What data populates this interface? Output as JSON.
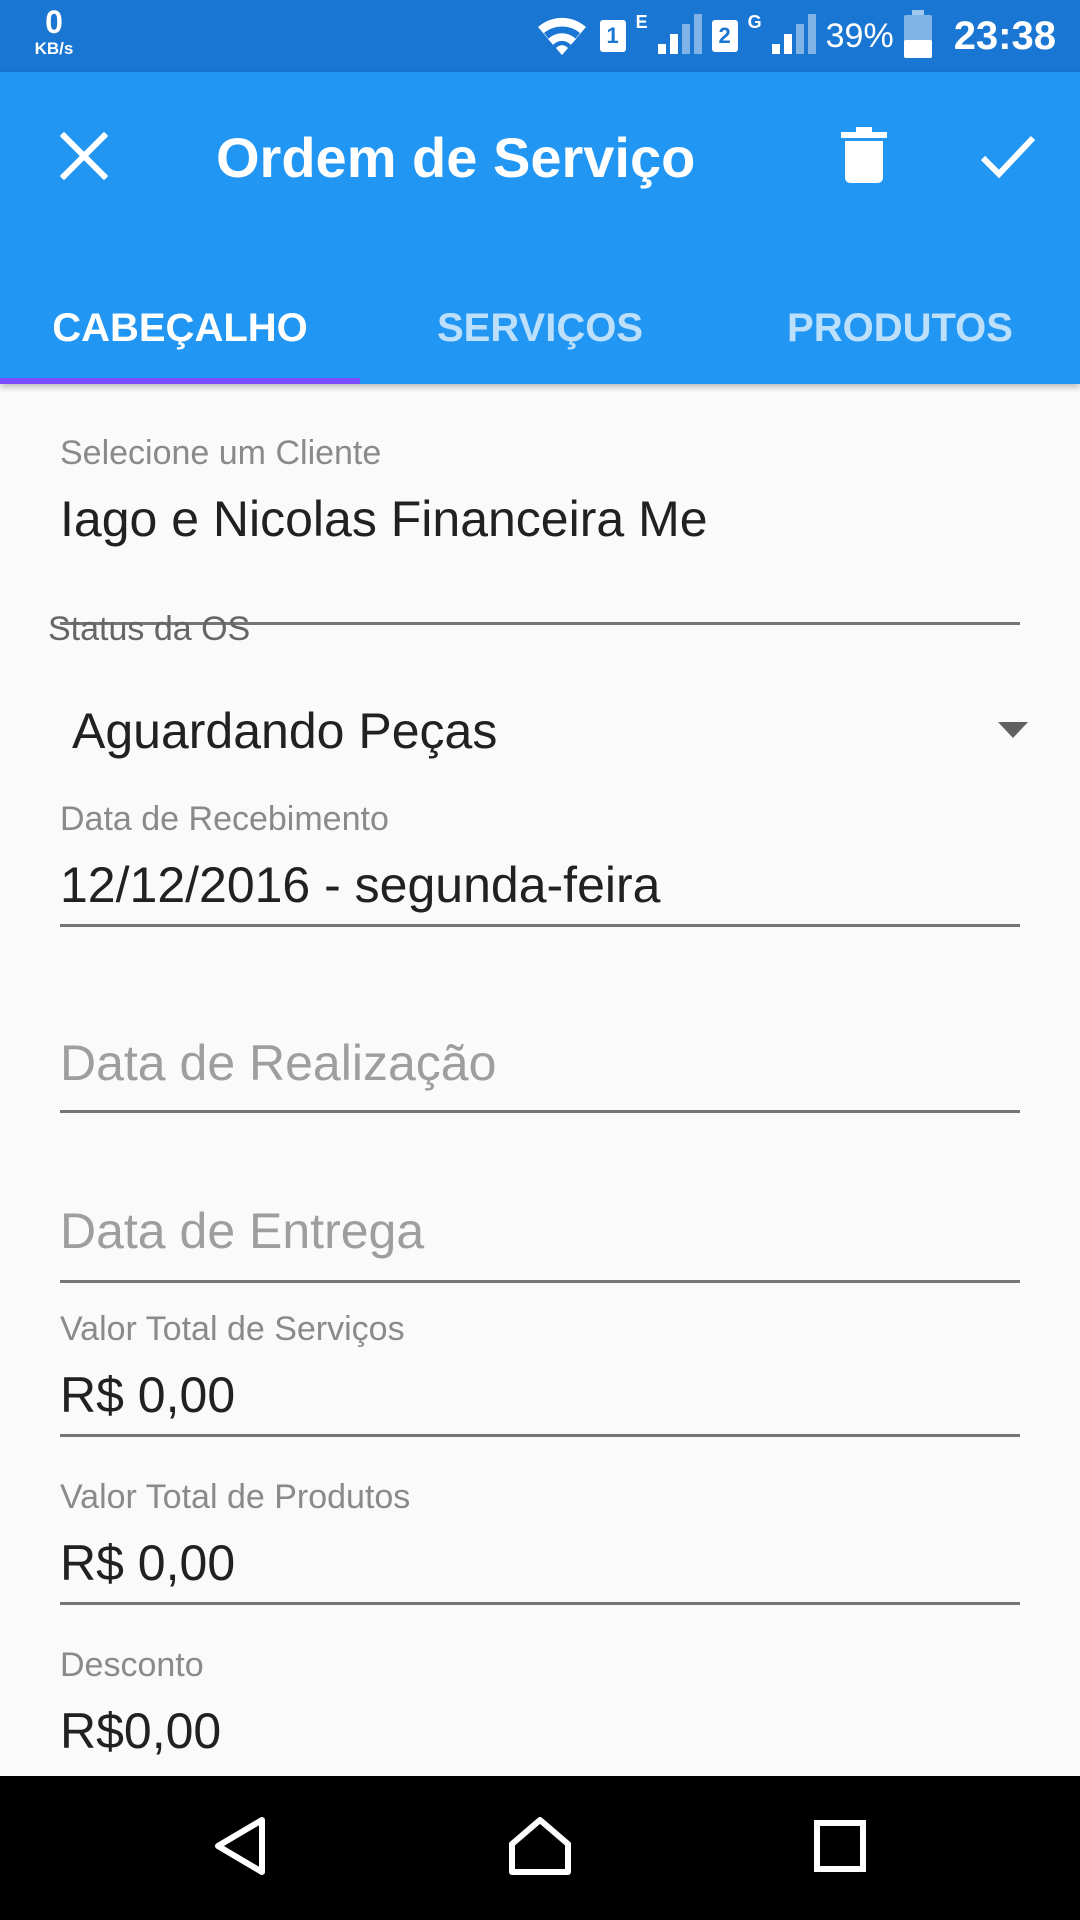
{
  "status_bar": {
    "net_speed_value": "0",
    "net_speed_unit": "KB/s",
    "sim1": "1",
    "sim1_type": "E",
    "sim2": "2",
    "sim2_type": "G",
    "battery": "39%",
    "time": "23:38"
  },
  "app_bar": {
    "title": "Ordem de Serviço",
    "close_icon": "close-icon",
    "delete_icon": "trash-icon",
    "confirm_icon": "check-icon"
  },
  "tabs": [
    {
      "label": "CABEÇALHO",
      "active": true
    },
    {
      "label": "SERVIÇOS",
      "active": false
    },
    {
      "label": "PRODUTOS",
      "active": false
    }
  ],
  "form": {
    "client": {
      "label": "Selecione um Cliente",
      "value": "Iago e Nicolas Financeira Me"
    },
    "status": {
      "label": "Status da OS",
      "value": "Aguardando Peças"
    },
    "received_date": {
      "label": "Data de Recebimento",
      "value": "12/12/2016 -  segunda-feira"
    },
    "completion_date": {
      "placeholder": "Data de Realização"
    },
    "delivery_date": {
      "placeholder": "Data de Entrega"
    },
    "services_total": {
      "label": "Valor Total de Serviços",
      "value": "R$ 0,00"
    },
    "products_total": {
      "label": "Valor Total de Produtos",
      "value": "R$ 0,00"
    },
    "discount": {
      "label": "Desconto",
      "value": "R$0,00"
    }
  },
  "colors": {
    "status_bar": "#1976D2",
    "app_bar": "#2196F3",
    "tab_indicator": "#7C4DFF"
  }
}
